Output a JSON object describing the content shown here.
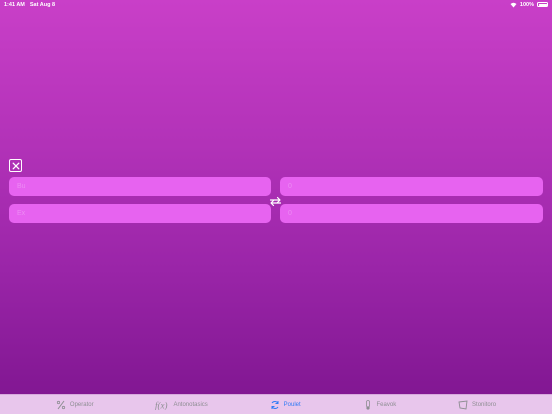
{
  "status_bar": {
    "time": "1:41 AM",
    "date": "Sat Aug 8",
    "battery": "100%"
  },
  "converter": {
    "top_left_placeholder": "Bu",
    "top_right_placeholder": "0",
    "bottom_left_placeholder": "Ex",
    "bottom_right_placeholder": "0"
  },
  "tabs": [
    {
      "label": "Operator",
      "icon": "percent-icon",
      "active": false
    },
    {
      "label": "Antonotasics",
      "icon": "function-icon",
      "active": false
    },
    {
      "label": "Poulet",
      "icon": "convert-icon",
      "active": true
    },
    {
      "label": "Feavok",
      "icon": "thermometer-icon",
      "active": false
    },
    {
      "label": "Stonitoro",
      "icon": "shape-icon",
      "active": false
    }
  ],
  "colors": {
    "accent": "#2f7bf5",
    "field": "#e763f0",
    "background_top": "#c93fc8",
    "background_bottom": "#7e158f"
  }
}
